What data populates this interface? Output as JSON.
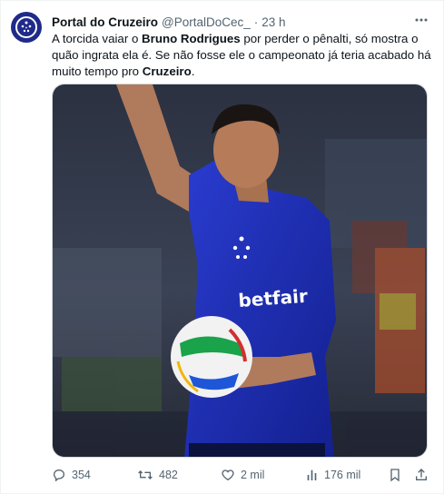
{
  "tweet": {
    "author_name": "Portal do Cruzeiro",
    "handle": "@PortalDoCec_",
    "separator": "·",
    "time": "23 h",
    "text": {
      "p1": "A torcida vaiar o ",
      "b1": "Bruno Rodrigues",
      "p2": " por perder o pênalti, só mostra o quão ingrata ela é. Se não fosse ele o campeonato já teria acabado há muito tempo pro ",
      "b2": "Cruzeiro",
      "p3": "."
    },
    "image": {
      "jersey_text": "betfair"
    },
    "stats": {
      "replies": "354",
      "reposts": "482",
      "likes": "2 mil",
      "views": "176 mil"
    },
    "icons": {
      "more": "more-icon",
      "reply": "reply-icon",
      "repost": "repost-icon",
      "like": "like-icon",
      "views": "views-icon",
      "bookmark": "bookmark-icon",
      "share": "share-icon"
    },
    "colors": {
      "avatar_bg": "#1f2a8a",
      "jersey": "#1d2fb8",
      "text_secondary": "#536471"
    }
  }
}
